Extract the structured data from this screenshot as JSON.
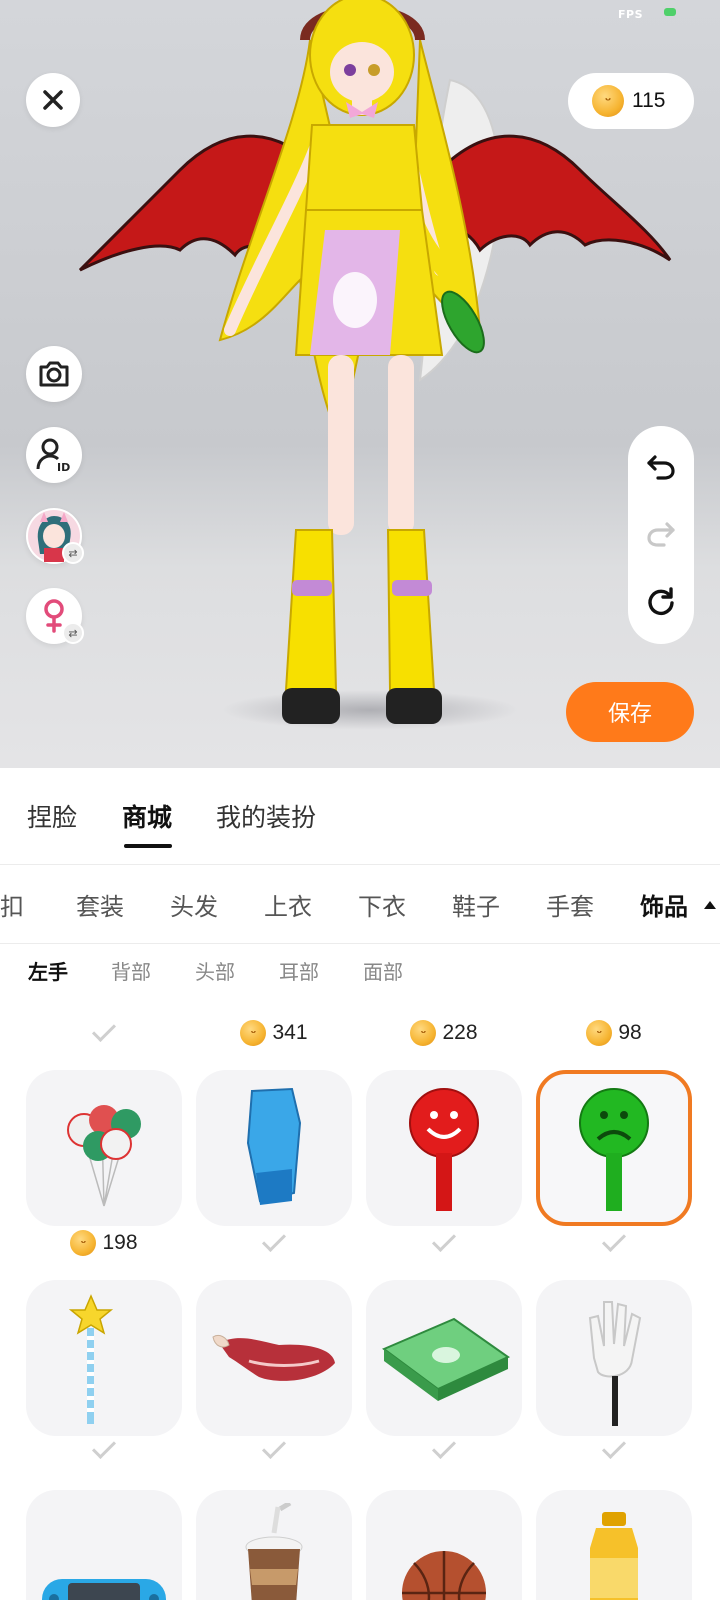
{
  "status": {
    "fps_label": "FPS"
  },
  "wallet": {
    "coin_icon": "rabbit-coin-icon",
    "balance": "115"
  },
  "left_tools": [
    {
      "name": "camera-button",
      "icon": "camera-icon"
    },
    {
      "name": "profile-id-button",
      "icon": "user-id-icon"
    },
    {
      "name": "switch-avatar-button",
      "icon": "avatar-thumbnail"
    },
    {
      "name": "switch-gender-button",
      "icon": "female-icon"
    }
  ],
  "history": {
    "undo_icon": "undo-icon",
    "redo_icon": "redo-icon",
    "reset_icon": "reset-icon"
  },
  "save_label": "保存",
  "tabs": [
    "捏脸",
    "商城",
    "我的装扮"
  ],
  "active_tab": "商城",
  "categories": [
    "折扣",
    "套装",
    "头发",
    "上衣",
    "下衣",
    "鞋子",
    "手套",
    "饰品"
  ],
  "active_category": "饰品",
  "subcategories": [
    "左手",
    "背部",
    "头部",
    "耳部",
    "面部"
  ],
  "active_subcategory": "左手",
  "items": [
    {
      "name": "balloons",
      "price": null,
      "owned": true,
      "selected": false
    },
    {
      "name": "boxing-glove",
      "price": "341",
      "owned": false,
      "selected": false
    },
    {
      "name": "red-smile-sign",
      "price": "228",
      "owned": false,
      "selected": false
    },
    {
      "name": "green-sad-sign",
      "price": "98",
      "owned": false,
      "selected": true
    },
    {
      "name": "star-wand",
      "price": "198",
      "owned": false,
      "selected": false
    },
    {
      "name": "raw-meat",
      "price": null,
      "owned": true,
      "selected": false
    },
    {
      "name": "cash-stack",
      "price": null,
      "owned": true,
      "selected": false
    },
    {
      "name": "white-glove-stick",
      "price": null,
      "owned": true,
      "selected": false
    },
    {
      "name": "game-console",
      "price": null,
      "owned": true,
      "selected": false
    },
    {
      "name": "coffee-cup",
      "price": null,
      "owned": true,
      "selected": false
    },
    {
      "name": "basketball",
      "price": null,
      "owned": true,
      "selected": false
    },
    {
      "name": "drink-bottle",
      "price": null,
      "owned": true,
      "selected": false
    }
  ],
  "colors": {
    "accent": "#ff7a1a",
    "selected_border": "#f07a22",
    "coin": "#f6b431"
  }
}
